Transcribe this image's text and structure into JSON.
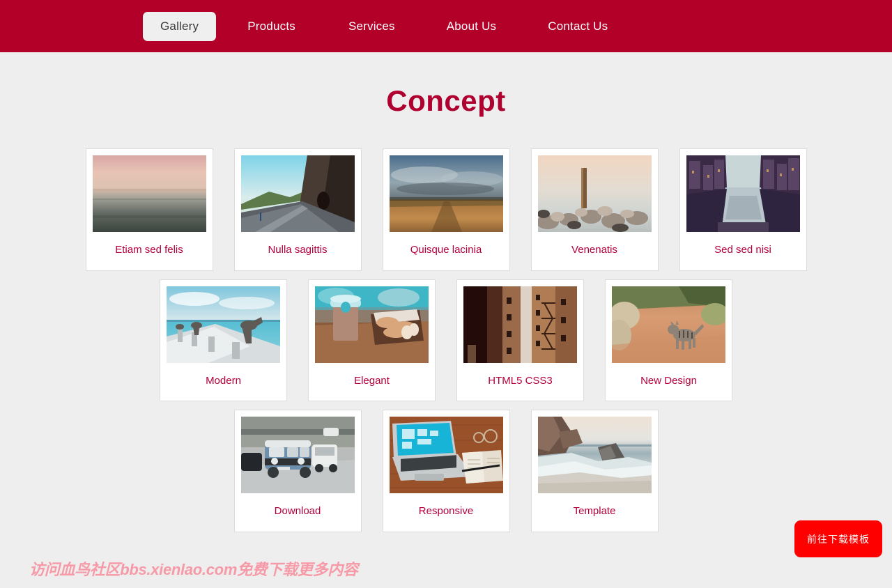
{
  "theme": {
    "nav_bg": "#b30029",
    "page_bg": "#eeeeee",
    "accent": "#b00030",
    "caption_color": "#b3003a",
    "active_tab_bg": "#efefef",
    "download_btn_bg": "#fe0000",
    "watermark_color": "#f79aa8"
  },
  "nav": {
    "items": [
      {
        "label": "Gallery",
        "active": true
      },
      {
        "label": "Products",
        "active": false
      },
      {
        "label": "Services",
        "active": false
      },
      {
        "label": "About Us",
        "active": false
      },
      {
        "label": "Contact Us",
        "active": false
      }
    ]
  },
  "main": {
    "title": "Concept",
    "rows": [
      {
        "cards": [
          {
            "caption": "Etiam sed felis",
            "image": "sunset-over-sea"
          },
          {
            "caption": "Nulla sagittis",
            "image": "mountain-road-cliff"
          },
          {
            "caption": "Quisque lacinia",
            "image": "field-under-clouds"
          },
          {
            "caption": "Venenatis",
            "image": "wooden-post-and-rocks"
          },
          {
            "caption": "Sed sed nisi",
            "image": "canal-between-buildings"
          }
        ]
      },
      {
        "cards": [
          {
            "caption": "Modern",
            "image": "pelicans-on-pier"
          },
          {
            "caption": "Elegant",
            "image": "coffee-cup-and-pastries"
          },
          {
            "caption": "HTML5 CSS3",
            "image": "city-fire-escapes"
          },
          {
            "caption": "New Design",
            "image": "wild-cat-on-dirt-road"
          }
        ]
      },
      {
        "cards": [
          {
            "caption": "Download",
            "image": "vintage-van-in-traffic"
          },
          {
            "caption": "Responsive",
            "image": "laptop-and-notebook-desk"
          },
          {
            "caption": "Template",
            "image": "rocks-in-ocean-surf"
          }
        ]
      }
    ]
  },
  "download_button": {
    "label": "前往下载模板"
  },
  "watermark": {
    "text": "访问血鸟社区bbs.xienlao.com免费下载更多内容"
  }
}
